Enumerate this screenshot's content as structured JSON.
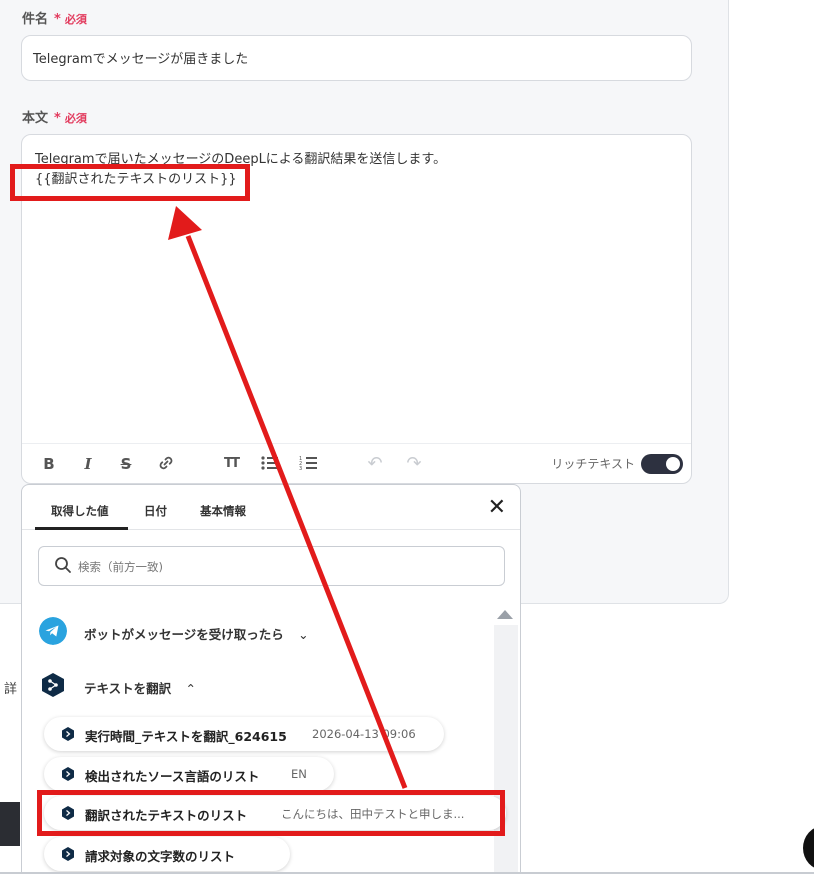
{
  "subject": {
    "label": "件名",
    "required_star": "*",
    "required_text": "必須",
    "value": "Telegramでメッセージが届きました"
  },
  "body": {
    "label": "本文",
    "required_star": "*",
    "required_text": "必須",
    "line1": "Telegramで届いたメッセージのDeepLによる翻訳結果を送信します。",
    "line2": "{{翻訳されたテキストのリスト}}"
  },
  "toolbar": {
    "bold": "B",
    "italic": "I",
    "strike": "S",
    "link_icon": "link-icon",
    "heading": "TT",
    "bullet_list_icon": "bullet-list-icon",
    "numbered_list_icon": "numbered-list-icon",
    "undo": "↶",
    "redo": "↷",
    "rich_text_label": "リッチテキスト",
    "rich_text_enabled": true
  },
  "panel": {
    "tabs": [
      "取得した値",
      "日付",
      "基本情報"
    ],
    "active_tab": 0,
    "close": "✕",
    "search_placeholder": "検索（前方一致)",
    "sources": [
      {
        "label": "ボットがメッセージを受け取ったら",
        "chevron": "⌄",
        "icon": "telegram-icon"
      },
      {
        "label": "テキストを翻訳",
        "chevron": "⌃",
        "icon": "deepl-icon"
      }
    ],
    "items": [
      {
        "name": "実行時間_テキストを翻訳_624615",
        "value": "2026-04-13 09:06"
      },
      {
        "name": "検出されたソース言語のリスト",
        "value": "EN"
      },
      {
        "name": "翻訳されたテキストのリスト",
        "value": "こんにちは、田中テストと申しま..."
      },
      {
        "name": "請求対象の文字数のリスト",
        "value": ""
      }
    ]
  },
  "side_label": "詳",
  "colors": {
    "required": "#e23a5d",
    "annotation": "#e21b1b",
    "telegram": "#2aa3df",
    "deepl": "#0f2b46"
  }
}
